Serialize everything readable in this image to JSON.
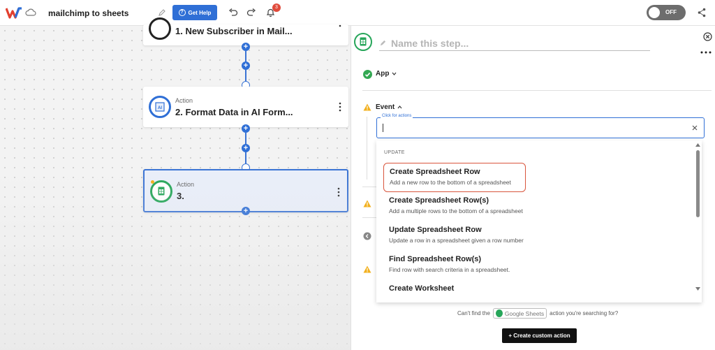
{
  "header": {
    "title": "mailchimp to sheets",
    "help_label": "Get Help",
    "notification_count": "3",
    "toggle_label": "OFF"
  },
  "workflow": {
    "nodes": [
      {
        "kind": "",
        "title": "1. New Subscriber in Mail..."
      },
      {
        "kind": "Action",
        "title": "2. Format Data in AI Form..."
      },
      {
        "kind": "Action",
        "title": "3."
      }
    ]
  },
  "panel": {
    "step_name_placeholder": "Name this step...",
    "app_label": "App",
    "event_label": "Event",
    "search_label": "Click for actions",
    "search_value": "",
    "group_label": "UPDATE",
    "options": [
      {
        "title": "Create Spreadsheet Row",
        "desc": "Add a new row to the bottom of a spreadsheet",
        "selected": true
      },
      {
        "title": "Create Spreadsheet Row(s)",
        "desc": "Add a multiple rows to the bottom of a spreadsheet",
        "selected": false
      },
      {
        "title": "Update Spreadsheet Row",
        "desc": "Update a row in a spreadsheet given a row number",
        "selected": false
      },
      {
        "title": "Find Spreadsheet Row(s)",
        "desc": "Find row with search criteria in a spreadsheet.",
        "selected": false
      },
      {
        "title": "Create Worksheet",
        "desc": "",
        "selected": false
      }
    ],
    "footer": {
      "prefix": "Can't find the",
      "app_chip": "Google Sheets",
      "suffix": "action you're searching for?"
    },
    "custom_action_label": "+ Create custom action"
  },
  "colors": {
    "accent": "#2f6fd6",
    "success": "#34a853",
    "warning": "#f2b01e",
    "selected_outline": "#d9553c",
    "sheets_green": "#27a65a"
  },
  "icons": [
    "logo-icon",
    "cloud-icon",
    "pencil-icon",
    "help-icon",
    "undo-icon",
    "redo-icon",
    "bell-icon",
    "share-icon",
    "mailchimp-icon",
    "ai-formatter-icon",
    "google-sheets-icon",
    "kebab-icon",
    "close-icon",
    "more-icon",
    "check-icon",
    "chevron-down-icon",
    "chevron-up-icon",
    "warning-icon",
    "clear-icon"
  ]
}
